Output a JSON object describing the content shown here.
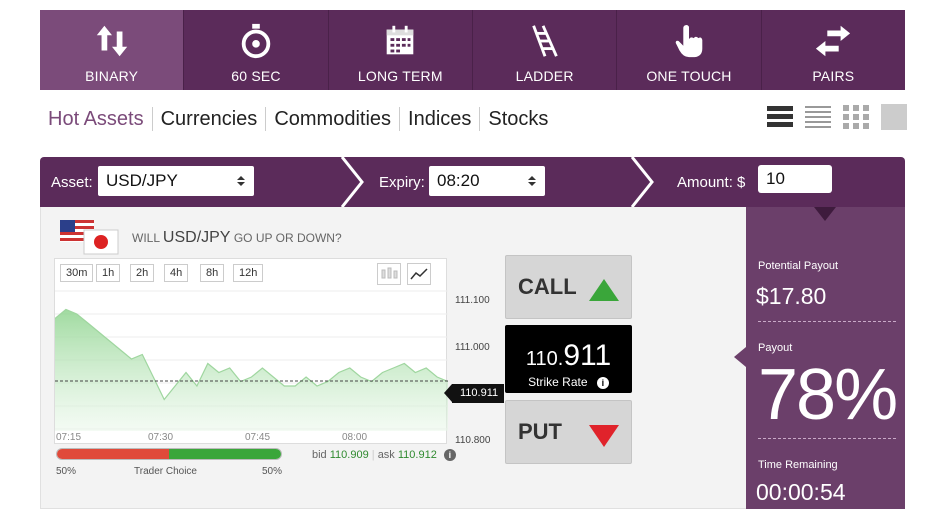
{
  "nav": [
    {
      "label": "BINARY",
      "icon": "up-down-arrows-icon",
      "active": true
    },
    {
      "label": "60 SEC",
      "icon": "stopwatch-icon"
    },
    {
      "label": "LONG TERM",
      "icon": "calendar-icon"
    },
    {
      "label": "LADDER",
      "icon": "ladder-icon"
    },
    {
      "label": "ONE TOUCH",
      "icon": "hand-pointer-icon"
    },
    {
      "label": "PAIRS",
      "icon": "left-right-arrows-icon"
    }
  ],
  "categories": [
    "Hot Assets",
    "Currencies",
    "Commodities",
    "Indices",
    "Stocks"
  ],
  "selectors": {
    "asset_label": "Asset:",
    "asset_value": "USD/JPY",
    "expiry_label": "Expiry:",
    "expiry_value": "08:20",
    "amount_label": "Amount: $",
    "amount_value": "10"
  },
  "question": {
    "pre": "WILL",
    "asset": "USD/JPY",
    "post": "GO UP OR DOWN?"
  },
  "timeframes": [
    "30m",
    "1h",
    "2h",
    "4h",
    "8h",
    "12h"
  ],
  "chart": {
    "y_labels": [
      "111.100",
      "111.000",
      "110.800"
    ],
    "x_labels": [
      "07:15",
      "07:30",
      "07:45",
      "08:00"
    ],
    "current": "110.911"
  },
  "trader_choice": {
    "label": "Trader Choice",
    "left_pct": "50%",
    "right_pct": "50%",
    "put_fraction": 0.5
  },
  "quote": {
    "bid_label": "bid",
    "bid": "110.909",
    "ask_label": "ask",
    "ask": "110.912"
  },
  "trade": {
    "call_label": "CALL",
    "put_label": "PUT",
    "strike_big": "110.",
    "strike_small": "911",
    "strike_label": "Strike Rate"
  },
  "payout": {
    "potential_label": "Potential Payout",
    "potential_value": "$17.80",
    "payout_label": "Payout",
    "payout_value": "78%",
    "time_label": "Time Remaining",
    "time_value": "00:00:54"
  },
  "colors": {
    "brand": "#5b2b5a",
    "call": "#3aa63a",
    "put": "#e04a3a"
  },
  "chart_data": {
    "type": "area",
    "x": [
      "07:15",
      "07:30",
      "07:45",
      "08:00"
    ],
    "ylim": [
      110.8,
      111.12
    ],
    "series": [
      {
        "values": [
          111.05,
          111.07,
          111.06,
          111.04,
          111.02,
          111.0,
          110.98,
          110.96,
          110.97,
          110.92,
          110.87,
          110.9,
          110.93,
          110.9,
          110.95,
          110.93,
          110.94,
          110.91,
          110.92,
          110.94,
          110.92,
          110.9,
          110.9,
          110.92,
          110.9,
          110.91,
          110.93,
          110.94,
          110.92,
          110.91,
          110.93,
          110.94,
          110.95,
          110.93,
          110.94,
          110.92,
          110.91
        ]
      }
    ]
  }
}
